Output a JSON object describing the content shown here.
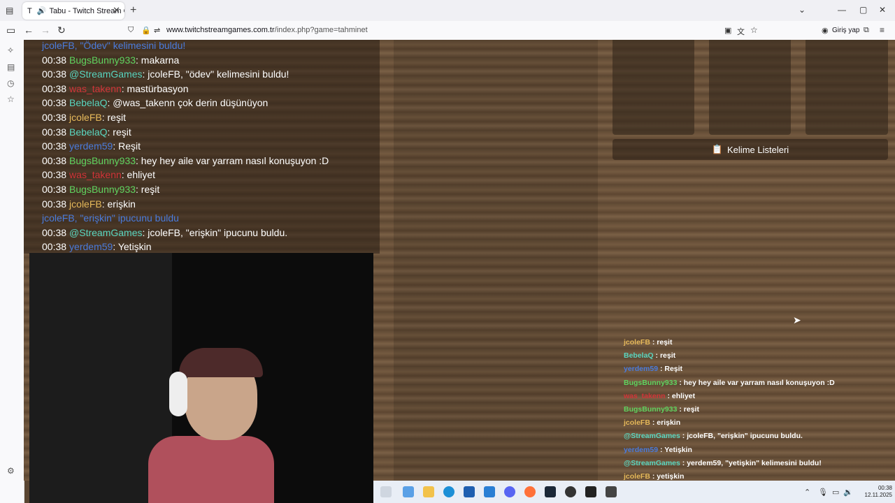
{
  "browser": {
    "tab_title": "Tabu - Twitch Stream Games",
    "url_domain": "www.twitchstreamgames.com.tr",
    "url_path": "/index.php?game=tahminet",
    "login_label": "Giriş yap"
  },
  "colors": {
    "green": "#5fd35f",
    "gold": "#e6b95a",
    "blue": "#4a7bdc",
    "red": "#d13438",
    "teal": "#5ad6c0"
  },
  "left_chat": [
    {
      "time": "",
      "user": "jcoleFB, \"Ödev\" kelimesini buldu!",
      "user_color": "#4a7bdc",
      "msg": ""
    },
    {
      "time": "00:38",
      "user": "BugsBunny933",
      "user_color": "#5fd35f",
      "msg": ": makarna"
    },
    {
      "time": "00:38",
      "user": "@StreamGames",
      "user_color": "#5ad6c0",
      "msg": ": jcoleFB, \"ödev\" kelimesini buldu!"
    },
    {
      "time": "00:38",
      "user": "was_takenn",
      "user_color": "#d13438",
      "msg": ": mastürbasyon"
    },
    {
      "time": "00:38",
      "user": "BebelaQ",
      "user_color": "#5ad6c0",
      "msg": ": @was_takenn çok derin düşünüyon"
    },
    {
      "time": "00:38",
      "user": "jcoleFB",
      "user_color": "#e6b95a",
      "msg": ": reşit"
    },
    {
      "time": "00:38",
      "user": "BebelaQ",
      "user_color": "#5ad6c0",
      "msg": ": reşit"
    },
    {
      "time": "00:38",
      "user": "yerdem59",
      "user_color": "#4a7bdc",
      "msg": ": Reşit"
    },
    {
      "time": "00:38",
      "user": "BugsBunny933",
      "user_color": "#5fd35f",
      "msg": ": hey hey aile var yarram nasıl konuşuyon :D"
    },
    {
      "time": "00:38",
      "user": "was_takenn",
      "user_color": "#d13438",
      "msg": ": ehliyet"
    },
    {
      "time": "00:38",
      "user": "BugsBunny933",
      "user_color": "#5fd35f",
      "msg": ": reşit"
    },
    {
      "time": "00:38",
      "user": "jcoleFB",
      "user_color": "#e6b95a",
      "msg": ": erişkin"
    },
    {
      "time": "",
      "user": "jcoleFB, \"erişkin\" ipucunu buldu",
      "user_color": "#4a7bdc",
      "msg": ""
    },
    {
      "time": "00:38",
      "user": "@StreamGames",
      "user_color": "#5ad6c0",
      "msg": ": jcoleFB, \"erişkin\" ipucunu buldu."
    },
    {
      "time": "00:38",
      "user": "yerdem59",
      "user_color": "#4a7bdc",
      "msg": ": Yetişkin"
    }
  ],
  "kelime_button": "Kelime Listeleri",
  "right_chat": [
    {
      "user": "jcoleFB",
      "user_color": "#e6b95a",
      "msg": " : reşit"
    },
    {
      "user": "BebelaQ",
      "user_color": "#5ad6c0",
      "msg": " : reşit"
    },
    {
      "user": "yerdem59",
      "user_color": "#4a7bdc",
      "msg": " : Reşit"
    },
    {
      "user": "BugsBunny933",
      "user_color": "#5fd35f",
      "msg": " : hey hey aile var yarram nasıl konuşuyon :D"
    },
    {
      "user": "was_takenn",
      "user_color": "#d13438",
      "msg": " : ehliyet"
    },
    {
      "user": "BugsBunny933",
      "user_color": "#5fd35f",
      "msg": " : reşit"
    },
    {
      "user": "jcoleFB",
      "user_color": "#e6b95a",
      "msg": " : erişkin"
    },
    {
      "user": "@StreamGames",
      "user_color": "#5ad6c0",
      "msg": " : jcoleFB, \"erişkin\" ipucunu buldu."
    },
    {
      "user": "yerdem59",
      "user_color": "#4a7bdc",
      "msg": " : Yetişkin"
    },
    {
      "user": "@StreamGames",
      "user_color": "#5ad6c0",
      "msg": " : yerdem59, \"yetişkin\" kelimesini buldu!"
    },
    {
      "user": "jcoleFB",
      "user_color": "#e6b95a",
      "msg": " : yetişkin"
    }
  ],
  "clock": {
    "time": "00:38",
    "date": "12.11.2025"
  }
}
